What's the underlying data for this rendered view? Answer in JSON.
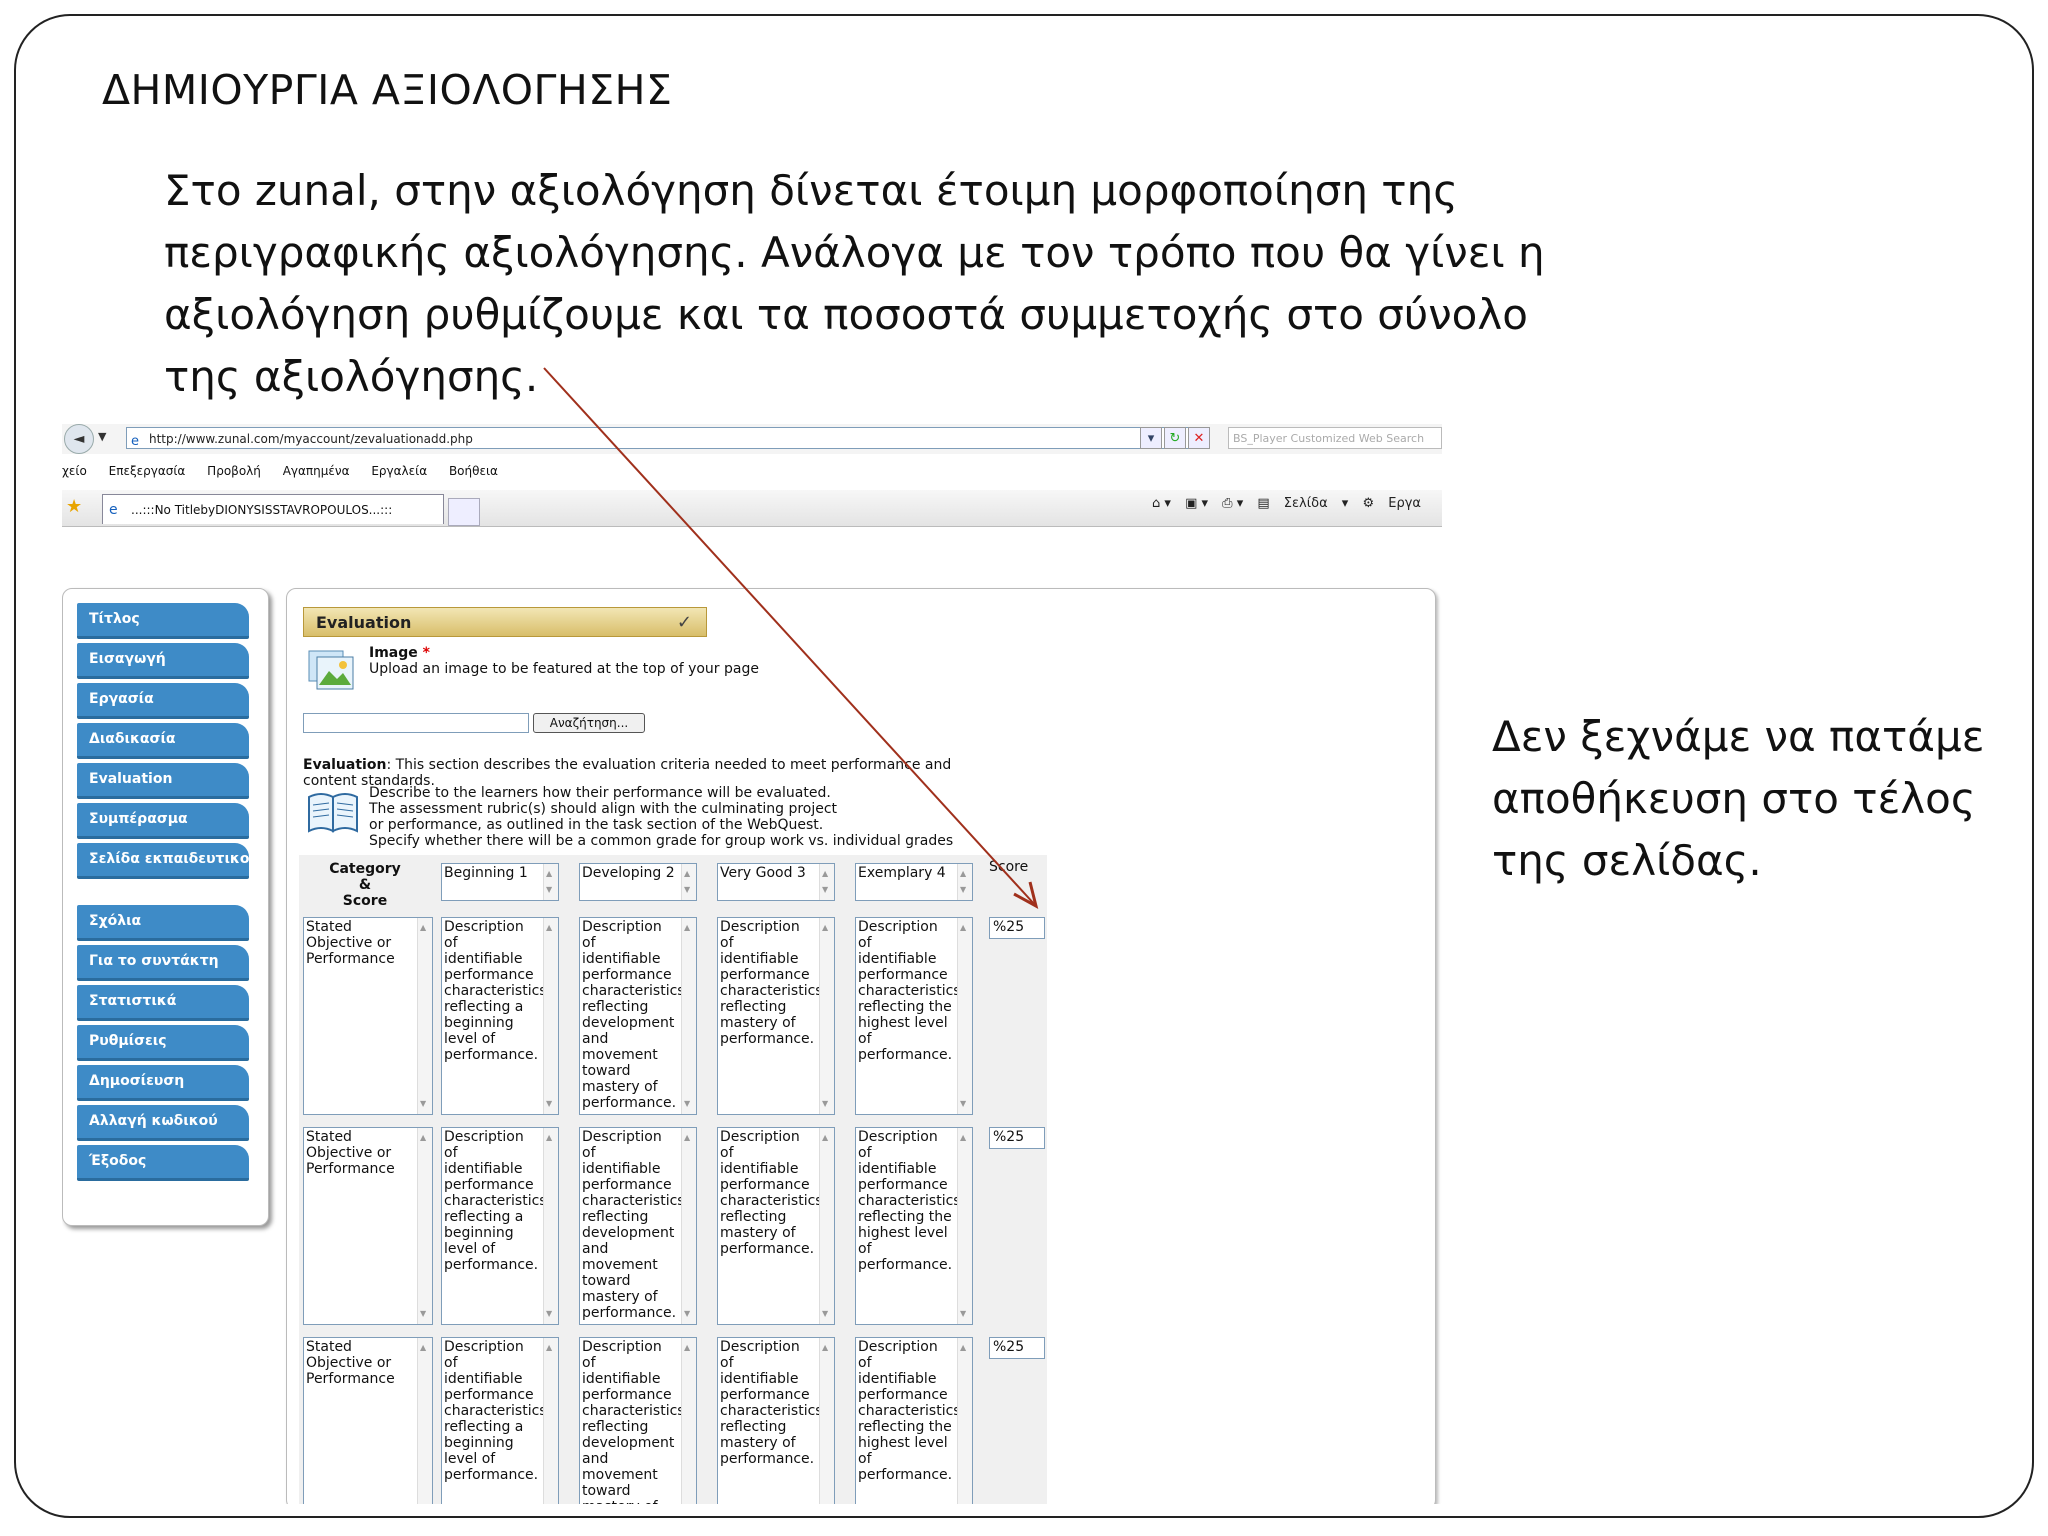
{
  "slide": {
    "title": "ΔΗΜΙΟΥΡΓΙΑ ΑΞΙΟΛΟΓΗΣΗΣ",
    "intro_lines": [
      "Στο zunal, στην αξιολόγηση δίνεται έτοιμη μορφοποίηση της",
      "περιγραφικής αξιολόγησης. Ανάλογα με τον τρόπο που θα γίνει η",
      "αξιολόγηση ρυθμίζουμε και τα ποσοστά συμμετοχής στο σύνολο",
      "της αξιολόγησης."
    ],
    "reminder_lines": [
      "Δεν ξεχνάμε να πατάμε",
      "αποθήκευση στο τέλος",
      "της σελίδας."
    ],
    "arrow_color": "#a0301c"
  },
  "browser": {
    "url": "http://www.zunal.com/myaccount/zevaluationadd.php",
    "search_placeholder": "BS_Player Customized Web Search",
    "menu": [
      "χείο",
      "Επεξεργασία",
      "Προβολή",
      "Αγαπημένα",
      "Εργαλεία",
      "Βοήθεια"
    ],
    "tab_title": "...:::No TitlebyDIONYSISSTAVROPOULOS...:::",
    "tools": [
      "Σελίδα",
      "Εργα"
    ]
  },
  "sidebar": {
    "items": [
      "Τίτλος",
      "Εισαγωγή",
      "Εργασία",
      "Διαδικασία",
      "Evaluation",
      "Συμπέρασμα",
      "Σελίδα εκπαιδευτικού",
      "Σχόλια",
      "Για το συντάκτη",
      "Στατιστικά",
      "Ρυθμίσεις",
      "Δημοσίευση",
      "Αλλαγή κωδικού",
      "Έξοδος"
    ],
    "color": "#3e8bc7"
  },
  "panel": {
    "header": "Evaluation",
    "image_label": "Image",
    "image_required": "*",
    "image_help": "Upload an image to be featured at the top of your page",
    "browse_label": "Αναζήτηση...",
    "eval_label": "Evaluation",
    "eval_desc": ": This section describes the evaluation criteria needed to meet performance and content standards.",
    "notes": [
      "Describe to the learners how their performance will be evaluated.",
      "The assessment rubric(s) should align with the culminating project",
      "or performance, as outlined in the task section of the WebQuest.",
      "Specify whether there will be a common grade for group work vs. individual grades"
    ]
  },
  "rubric": {
    "category_header": [
      "Category",
      "&",
      "Score"
    ],
    "levels": [
      "Beginning 1",
      "Developing 2",
      "Very Good 3",
      "Exemplary 4"
    ],
    "score_header": "Score",
    "rows": [
      {
        "category": "Stated Objective or Performance",
        "cells": [
          "Description of identifiable performance characteristics reflecting a beginning level of performance.",
          "Description of identifiable performance characteristics reflecting development and movement toward mastery of performance.",
          "Description of identifiable performance characteristics reflecting mastery of performance.",
          "Description of identifiable performance characteristics reflecting the highest level of performance."
        ],
        "score": "%25"
      },
      {
        "category": "Stated Objective or Performance",
        "cells": [
          "Description of identifiable performance characteristics reflecting a beginning level of performance.",
          "Description of identifiable performance characteristics reflecting development and movement toward mastery of performance.",
          "Description of identifiable performance characteristics reflecting mastery of performance.",
          "Description of identifiable performance characteristics reflecting the highest level of performance."
        ],
        "score": "%25"
      },
      {
        "category": "Stated Objective or Performance",
        "cells": [
          "Description of identifiable performance characteristics reflecting a beginning level of performance.",
          "Description of identifiable performance characteristics reflecting development and movement toward mastery of performance.",
          "Description of identifiable performance characteristics reflecting mastery of performance.",
          "Description of identifiable performance characteristics reflecting the highest level of performance."
        ],
        "score": "%25"
      }
    ]
  }
}
